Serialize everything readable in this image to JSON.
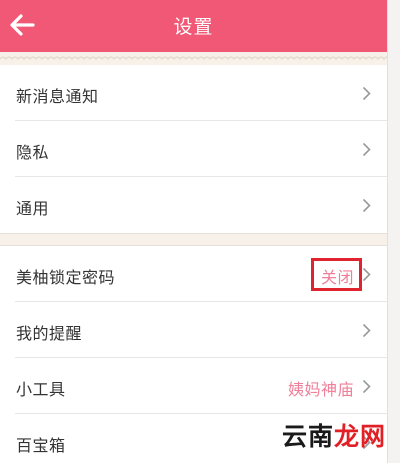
{
  "header": {
    "title": "设置",
    "back_icon": "arrow-left-icon"
  },
  "colors": {
    "header_bg": "#f15876",
    "accent_text": "#f0809a",
    "highlight_border": "#e0232f",
    "band_bg": "#f7f1ea"
  },
  "groups": [
    {
      "items": [
        {
          "label": "新消息通知"
        },
        {
          "label": "隐私"
        },
        {
          "label": "通用"
        }
      ]
    },
    {
      "items": [
        {
          "label": "美柚锁定密码",
          "value": "关闭"
        },
        {
          "label": "我的提醒"
        },
        {
          "label": "小工具",
          "value": "姨妈神庙"
        },
        {
          "label": "百宝箱"
        }
      ]
    }
  ],
  "watermark": {
    "part1": "云南",
    "part2": "龙网"
  }
}
